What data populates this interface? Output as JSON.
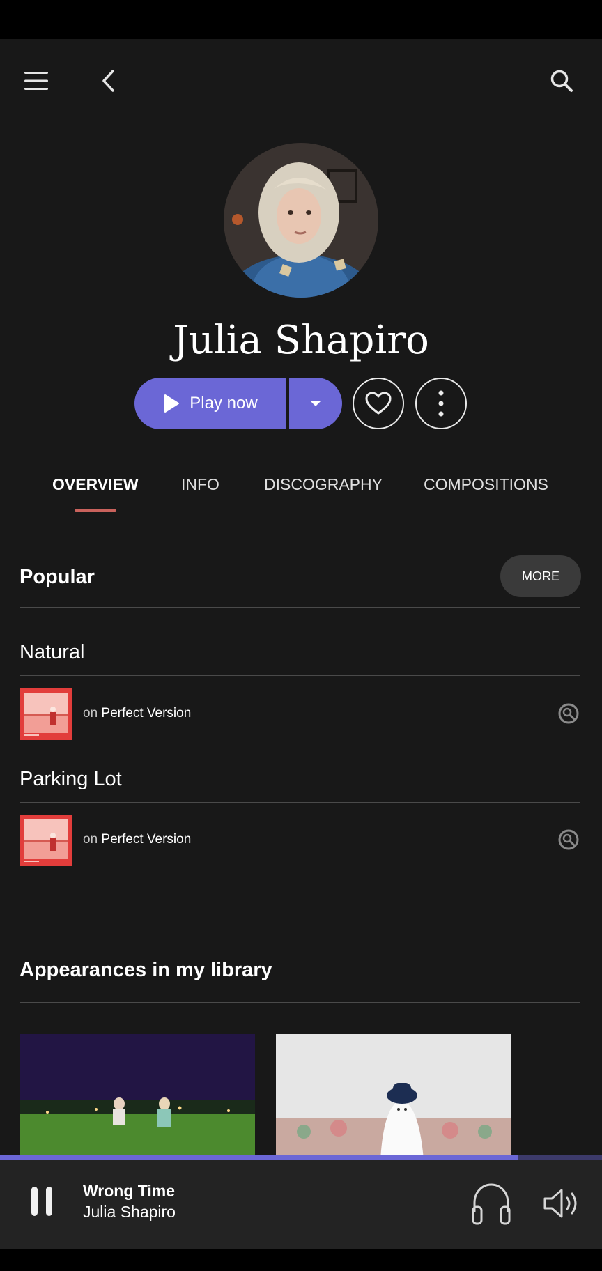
{
  "artist": {
    "name": "Julia Shapiro"
  },
  "actions": {
    "play_label": "Play now"
  },
  "tabs": [
    {
      "label": "OVERVIEW",
      "active": true
    },
    {
      "label": "INFO"
    },
    {
      "label": "DISCOGRAPHY"
    },
    {
      "label": "COMPOSITIONS"
    }
  ],
  "popular": {
    "title": "Popular",
    "more_label": "MORE",
    "tracks": [
      {
        "title": "Natural",
        "prefix": "on",
        "album": "Perfect Version"
      },
      {
        "title": "Parking Lot",
        "prefix": "on",
        "album": "Perfect Version"
      }
    ]
  },
  "appearances": {
    "title": "Appearances in my library"
  },
  "player": {
    "track": "Wrong Time",
    "artist": "Julia Shapiro",
    "progress": 0.86
  },
  "colors": {
    "accent": "#6b67d6",
    "tab_underline": "#c9625c",
    "background": "#181818",
    "player_background": "#232323",
    "album_art_red": "#e23d3b"
  },
  "icons": [
    "menu-icon",
    "back-arrow-icon",
    "search-icon",
    "play-icon",
    "caret-down-icon",
    "heart-icon",
    "more-vertical-icon",
    "search-track-icon",
    "pause-icon",
    "headphones-icon",
    "volume-icon"
  ]
}
